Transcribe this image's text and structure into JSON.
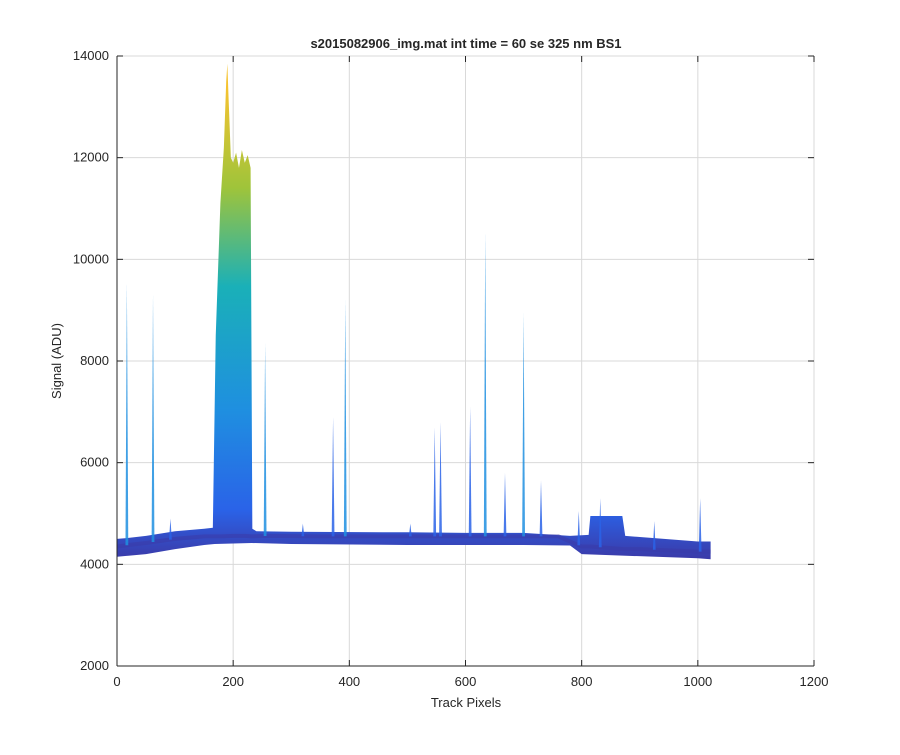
{
  "chart_data": {
    "type": "area",
    "title": "s2015082906_img.mat int time = 60 se  325 nm BS1",
    "xlabel": "Track Pixels",
    "ylabel": "Signal (ADU)",
    "xlim": [
      0,
      1200
    ],
    "ylim": [
      2000,
      14000
    ],
    "xticks": [
      0,
      200,
      400,
      600,
      800,
      1000,
      1200
    ],
    "yticks": [
      2000,
      4000,
      6000,
      8000,
      10000,
      12000,
      14000
    ],
    "grid": true,
    "legend": "none",
    "colors": {
      "low": "#3b3aa8",
      "mid_low": "#2a63e8",
      "mid": "#1f8fe0",
      "mid_high": "#1ab0b8",
      "high": "#9fc43a",
      "peak": "#f5c330",
      "grid": "#d9d9d9",
      "axis": "#262626"
    },
    "series": [
      {
        "values_x": [
          0,
          20,
          50,
          100,
          150,
          168,
          180,
          200,
          220,
          232,
          260,
          350,
          500,
          600,
          700,
          760,
          800,
          815,
          872,
          900,
          1000,
          1022
        ],
        "values_y": [
          4350,
          4380,
          4420,
          4500,
          4550,
          4550,
          4550,
          4560,
          4560,
          4550,
          4560,
          4550,
          4550,
          4550,
          4550,
          4550,
          4350,
          4350,
          4300,
          4300,
          4250,
          4250
        ]
      }
    ],
    "envelope": {
      "upper_x": [
        0,
        20,
        50,
        100,
        150,
        165,
        170,
        178,
        184,
        188,
        190,
        192,
        196,
        200,
        205,
        210,
        215,
        220,
        225,
        230,
        233,
        240,
        300,
        500,
        600,
        700,
        780,
        812,
        815,
        870,
        875,
        1000,
        1022
      ],
      "upper_y": [
        4500,
        4520,
        4560,
        4650,
        4700,
        4720,
        8500,
        11100,
        12200,
        13500,
        13850,
        13200,
        12000,
        11900,
        12100,
        11800,
        12150,
        11900,
        12050,
        11800,
        4700,
        4650,
        4640,
        4630,
        4620,
        4620,
        4560,
        4580,
        4950,
        4950,
        4560,
        4450,
        4450
      ],
      "lower_x": [
        0,
        50,
        100,
        150,
        168,
        232,
        300,
        500,
        700,
        780,
        800,
        1000,
        1022
      ],
      "lower_y": [
        4150,
        4200,
        4300,
        4380,
        4400,
        4420,
        4400,
        4380,
        4380,
        4370,
        4200,
        4120,
        4100
      ]
    },
    "spikes": [
      {
        "x": 17,
        "y": 9550
      },
      {
        "x": 62,
        "y": 9300
      },
      {
        "x": 92,
        "y": 4900
      },
      {
        "x": 255,
        "y": 8350
      },
      {
        "x": 320,
        "y": 4800
      },
      {
        "x": 372,
        "y": 6900
      },
      {
        "x": 393,
        "y": 9200
      },
      {
        "x": 505,
        "y": 4800
      },
      {
        "x": 547,
        "y": 6700
      },
      {
        "x": 557,
        "y": 6800
      },
      {
        "x": 608,
        "y": 7100
      },
      {
        "x": 634,
        "y": 10550
      },
      {
        "x": 668,
        "y": 5800
      },
      {
        "x": 700,
        "y": 8950
      },
      {
        "x": 730,
        "y": 5650
      },
      {
        "x": 795,
        "y": 5050
      },
      {
        "x": 832,
        "y": 5300
      },
      {
        "x": 925,
        "y": 4850
      },
      {
        "x": 1004,
        "y": 5300
      }
    ]
  }
}
